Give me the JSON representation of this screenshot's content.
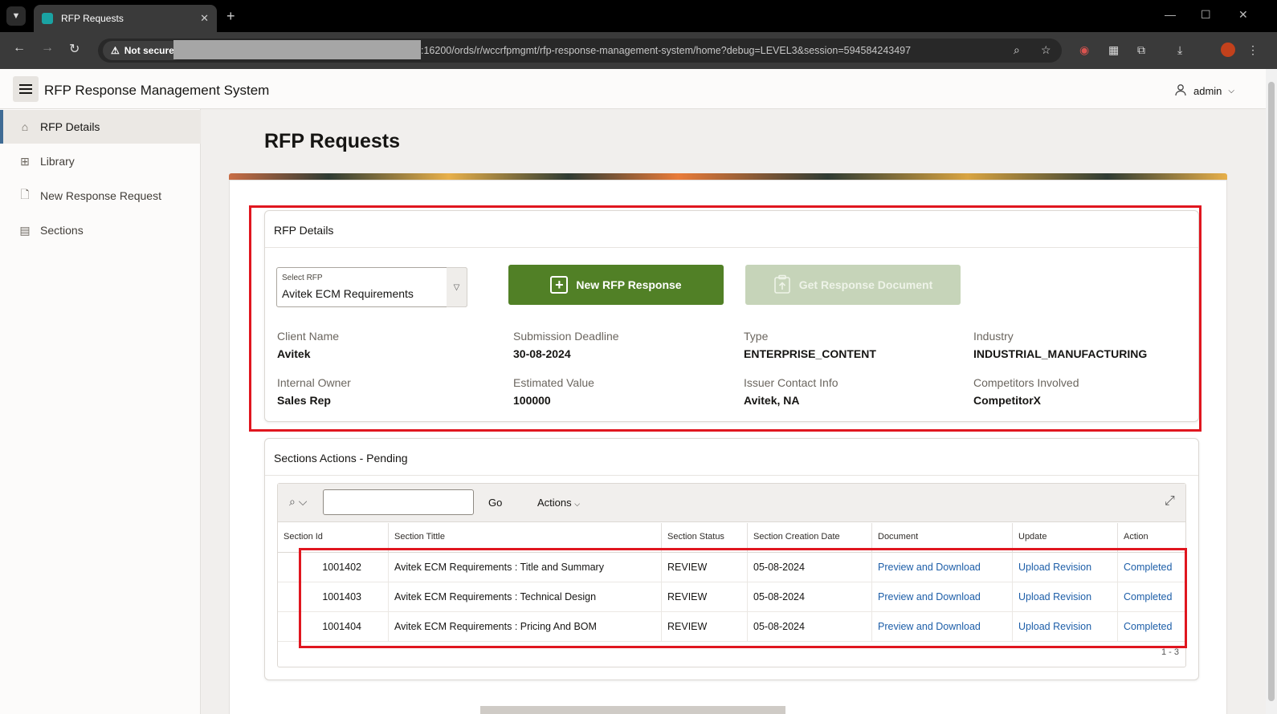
{
  "browser": {
    "tab_title": "RFP Requests",
    "security_label": "Not secure",
    "url_visible": ":16200/ords/r/wccrfpmgmt/rfp-response-management-system/home?debug=LEVEL3&session=594584243497"
  },
  "app": {
    "title": "RFP Response Management System",
    "user": "admin"
  },
  "sidebar": {
    "items": [
      {
        "label": "RFP Details",
        "icon": "home-icon"
      },
      {
        "label": "Library",
        "icon": "table-icon"
      },
      {
        "label": "New Response Request",
        "icon": "file-plus-icon"
      },
      {
        "label": "Sections",
        "icon": "grid-icon"
      }
    ]
  },
  "page": {
    "title": "RFP Requests"
  },
  "rfp_details": {
    "region_title": "RFP Details",
    "select_label": "Select RFP",
    "select_value": "Avitek ECM Requirements",
    "new_button": "New RFP Response",
    "get_button": "Get Response Document",
    "fields": {
      "client_name_label": "Client Name",
      "client_name": "Avitek",
      "deadline_label": "Submission Deadline",
      "deadline": "30-08-2024",
      "type_label": "Type",
      "type": "ENTERPRISE_CONTENT",
      "industry_label": "Industry",
      "industry": "INDUSTRIAL_MANUFACTURING",
      "owner_label": "Internal Owner",
      "owner": "Sales Rep",
      "value_label": "Estimated Value",
      "value": "100000",
      "contact_label": "Issuer Contact Info",
      "contact": "Avitek, NA",
      "competitors_label": "Competitors Involved",
      "competitors": "CompetitorX"
    }
  },
  "sections": {
    "region_title": "Sections Actions - Pending",
    "go_label": "Go",
    "actions_label": "Actions",
    "columns": [
      "Section Id",
      "Section Tittle",
      "Section Status",
      "Section Creation Date",
      "Document",
      "Update",
      "Action"
    ],
    "rows": [
      {
        "id": "1001402",
        "title": "Avitek ECM Requirements : Title and Summary",
        "status": "REVIEW",
        "date": "05-08-2024",
        "document": "Preview and Download",
        "update": "Upload Revision",
        "action": "Completed"
      },
      {
        "id": "1001403",
        "title": "Avitek ECM Requirements : Technical Design",
        "status": "REVIEW",
        "date": "05-08-2024",
        "document": "Preview and Download",
        "update": "Upload Revision",
        "action": "Completed"
      },
      {
        "id": "1001404",
        "title": "Avitek ECM Requirements : Pricing And BOM",
        "status": "REVIEW",
        "date": "05-08-2024",
        "document": "Preview and Download",
        "update": "Upload Revision",
        "action": "Completed"
      }
    ],
    "pagination": "1 - 3"
  },
  "colors": {
    "primary_button": "#518026",
    "disabled_button": "#c6d4b9",
    "link": "#1d5ea8",
    "highlight": "#e0161f"
  }
}
